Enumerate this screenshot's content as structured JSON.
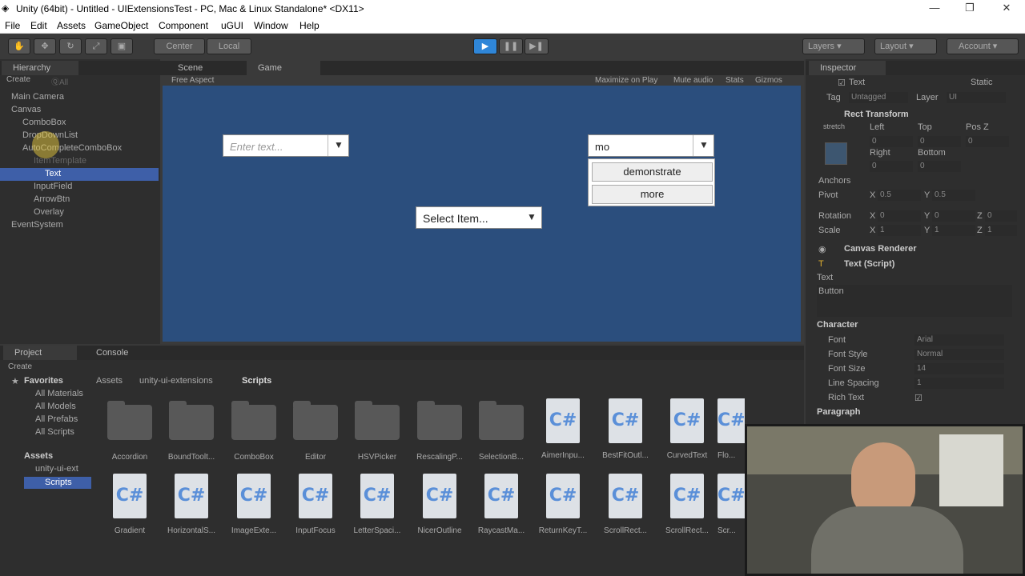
{
  "window": {
    "title": "Unity (64bit) - Untitled - UIExtensionsTest - PC, Mac & Linux Standalone* <DX11>"
  },
  "menu": [
    "File",
    "Edit",
    "Assets",
    "GameObject",
    "Component",
    "uGUI",
    "Window",
    "Help"
  ],
  "toolbar": {
    "center": "Center",
    "local": "Local",
    "layers": "Layers",
    "layout": "Layout",
    "account": "Account"
  },
  "hierarchy": {
    "tab": "Hierarchy",
    "create": "Create",
    "search": "ⓆAll",
    "items": [
      "Main Camera",
      "Canvas",
      "ComboBox",
      "DropDownList",
      "AutoCompleteComboBox",
      "ItemTemplate",
      "Text",
      "InputField",
      "ArrowBtn",
      "Overlay",
      "EventSystem"
    ]
  },
  "views": {
    "scene_tab": "Scene",
    "game_tab": "Game",
    "aspect": "Free Aspect",
    "maximize": "Maximize on Play",
    "mute": "Mute audio",
    "stats": "Stats",
    "gizmos": "Gizmos"
  },
  "game": {
    "enter_text": "Enter text...",
    "combo_value": "mo",
    "combo_options": [
      "demonstrate",
      "more"
    ],
    "select_item": "Select Item...",
    "arrow": "▼"
  },
  "inspector": {
    "tab": "Inspector",
    "object": "Text",
    "static": "Static",
    "tag_label": "Tag",
    "tag": "Untagged",
    "layer_label": "Layer",
    "layer": "UI",
    "rect_transform": "Rect Transform",
    "stretch": "stretch",
    "left": "Left",
    "top": "Top",
    "posz": "Pos Z",
    "right": "Right",
    "bottom": "Bottom",
    "v_left": "0",
    "v_top": "0",
    "v_posz": "0",
    "v_right": "0",
    "v_bottom": "0",
    "anchors": "Anchors",
    "pivot": "Pivot",
    "pivot_x": "0.5",
    "pivot_y": "0.5",
    "rotation": "Rotation",
    "rot_x": "0",
    "rot_y": "0",
    "rot_z": "0",
    "scale": "Scale",
    "scale_x": "1",
    "scale_y": "1",
    "scale_z": "1",
    "canvas_renderer": "Canvas Renderer",
    "text_script": "Text (Script)",
    "text_label": "Text",
    "text_value": "Button",
    "character": "Character",
    "font_label": "Font",
    "font": "Arial",
    "font_style_label": "Font Style",
    "font_style": "Normal",
    "font_size_label": "Font Size",
    "font_size": "14",
    "line_spacing_label": "Line Spacing",
    "line_spacing": "1",
    "rich_text_label": "Rich Text",
    "paragraph": "Paragraph"
  },
  "project": {
    "tab": "Project",
    "console_tab": "Console",
    "create": "Create",
    "favorites": "Favorites",
    "fav_items": [
      "All Materials",
      "All Models",
      "All Prefabs",
      "All Scripts"
    ],
    "assets": "Assets",
    "tree": [
      "unity-ui-ext",
      "Scripts"
    ],
    "breadcrumb": [
      "Assets",
      "unity-ui-extensions",
      "Scripts"
    ],
    "folders": [
      "Accordion",
      "BoundToolt...",
      "ComboBox",
      "Editor",
      "HSVPicker",
      "RescalingP...",
      "SelectionB..."
    ],
    "row1_scripts": [
      "AimerInpu...",
      "BestFitOutl...",
      "CurvedText",
      "Flo..."
    ],
    "row2_scripts": [
      "Gradient",
      "HorizontalS...",
      "ImageExte...",
      "InputFocus",
      "LetterSpaci...",
      "NicerOutline",
      "RaycastMa...",
      "ReturnKeyT...",
      "ScrollRect...",
      "ScrollRect...",
      "Scr..."
    ],
    "cs": "C#"
  },
  "colors": {
    "game_bg": "#2b4e7d",
    "selection": "#3e5fa8",
    "play_blue": "#2f86d8"
  }
}
